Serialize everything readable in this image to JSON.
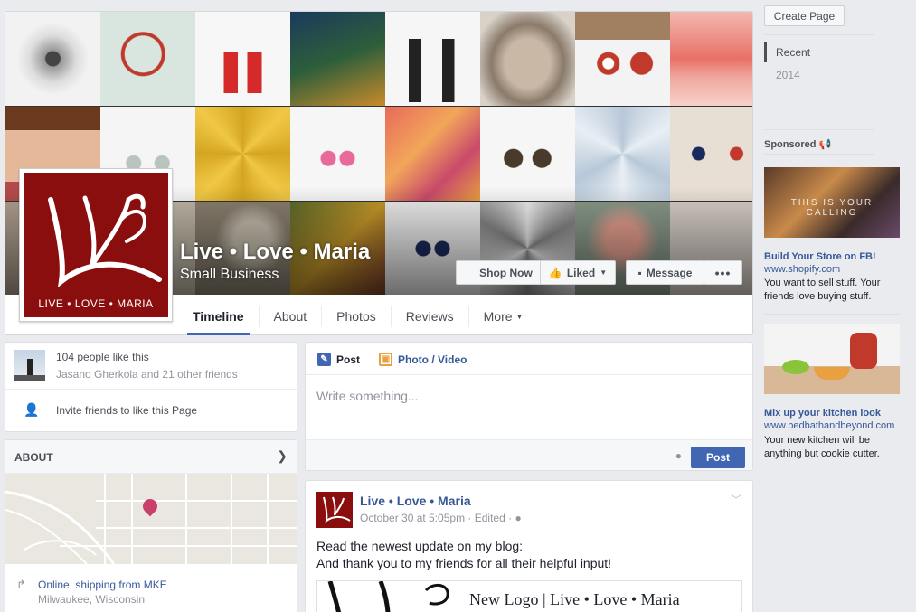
{
  "page": {
    "name": "Live • Love • Maria",
    "category": "Small Business",
    "logo_text": "LIVE • LOVE • MARIA"
  },
  "cover_buttons": {
    "shop_now": "Shop Now",
    "liked": "Liked",
    "message": "Message",
    "more": "•••"
  },
  "tabs": [
    "Timeline",
    "About",
    "Photos",
    "Reviews",
    "More"
  ],
  "right_rail": {
    "create_page": "Create Page",
    "years": [
      "Recent",
      "2014"
    ],
    "sponsored": "Sponsored",
    "ads": [
      {
        "banner": "THIS IS YOUR CALLING",
        "title": "Build Your Store on FB!",
        "url": "www.shopify.com",
        "text": "You want to sell stuff. Your friends love buying stuff."
      },
      {
        "title": "Mix up your kitchen look",
        "url": "www.bedbathandbeyond.com",
        "text": "Your new kitchen will be anything but cookie cutter."
      }
    ]
  },
  "likes": {
    "count": "104 people like this",
    "friends": "Jasano Gherkola and 21 other friends",
    "invite": "Invite friends to like this Page"
  },
  "about": {
    "title": "ABOUT",
    "address_line1": "Online, shipping from MKE",
    "address_line2": "Milwaukee, Wisconsin"
  },
  "composer": {
    "tab_post": "Post",
    "tab_photo": "Photo / Video",
    "placeholder": "Write something...",
    "post_button": "Post"
  },
  "post": {
    "author": "Live • Love • Maria",
    "meta": "October 30 at 5:05pm · Edited ·",
    "line1": "Read the newest update on my blog:",
    "line2": "And thank you to my friends for all their helpful input!",
    "link_title": "New Logo | Live • Love • Maria"
  },
  "colors": {
    "brand_red": "#8b0e0e",
    "fb_blue": "#4267b2",
    "link_blue": "#365899"
  }
}
